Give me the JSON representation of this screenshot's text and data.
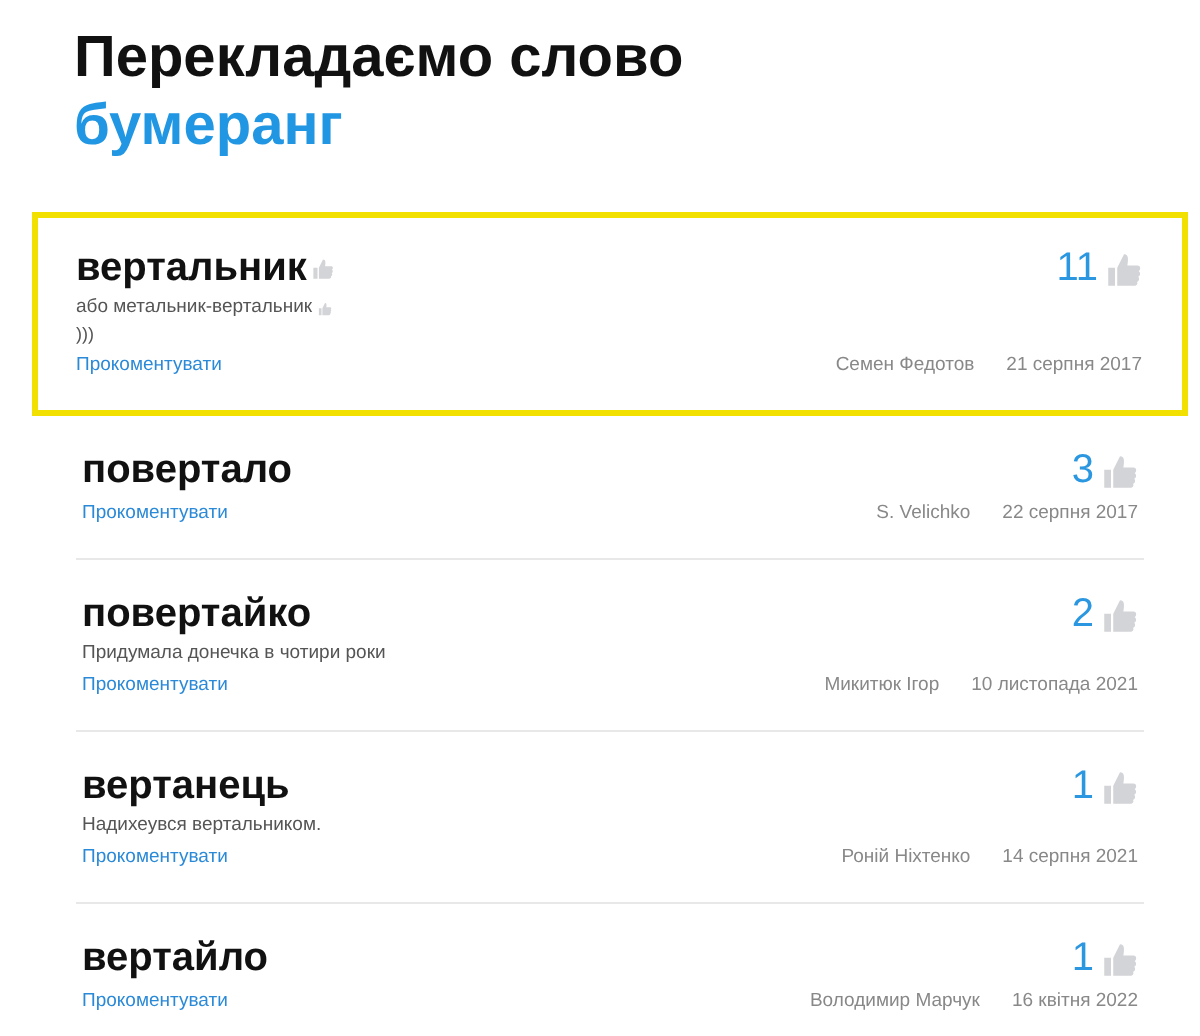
{
  "heading": {
    "line_1": "Перекладаємо слово",
    "word": "бумеранг"
  },
  "entries": [
    {
      "word": "вертальник",
      "highlighted": true,
      "note": "або метальник-вертальник",
      "extra": ")))",
      "votes": "11",
      "comment_link": "Прокоментувати",
      "author": "Семен Федотов",
      "date": "21 серпня 2017"
    },
    {
      "word": "повертало",
      "highlighted": false,
      "votes": "3",
      "comment_link": "Прокоментувати",
      "author": "S. Velichko",
      "date": "22 серпня 2017"
    },
    {
      "word": "повертайко",
      "highlighted": false,
      "note": "Придумала донечка в чотири роки",
      "votes": "2",
      "comment_link": "Прокоментувати",
      "author": "Микитюк Ігор",
      "date": "10 листопада 2021"
    },
    {
      "word": "вертанець",
      "highlighted": false,
      "note": "Надихеувся вертальником.",
      "votes": "1",
      "comment_link": "Прокоментувати",
      "author": "Роній Ніхтенко",
      "date": "14 серпня 2021"
    },
    {
      "word": "вертайло",
      "highlighted": false,
      "votes": "1",
      "comment_link": "Прокоментувати",
      "author": "Володимир Марчук",
      "date": "16 квітня 2022"
    }
  ]
}
